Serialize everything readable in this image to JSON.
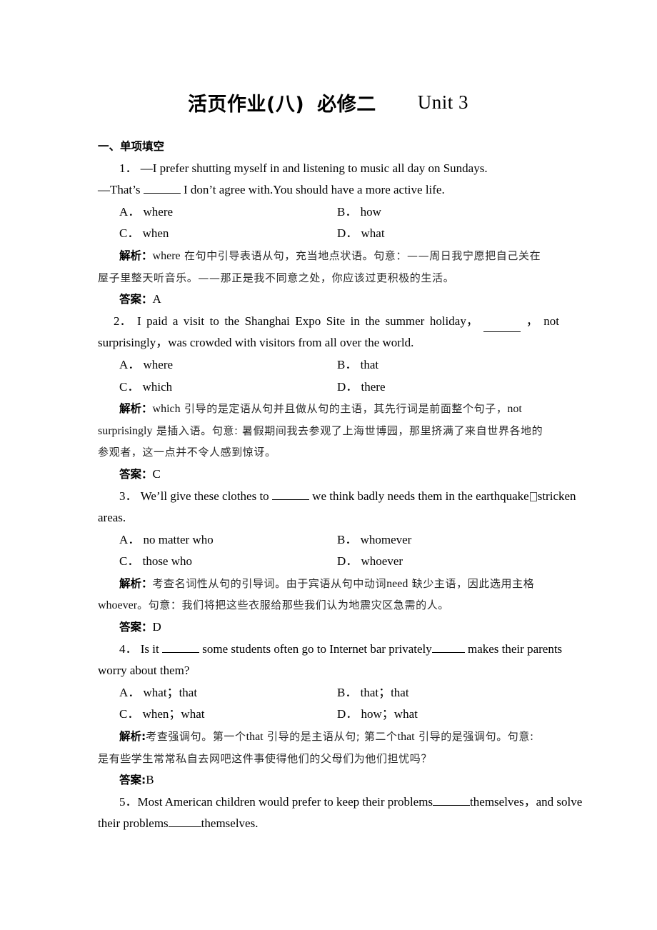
{
  "document": {
    "title_cn": "活页作业(八)",
    "title_cn2": "必修二",
    "title_en": "Unit 3"
  },
  "section": {
    "heading": "一、单项填空"
  },
  "labels": {
    "analysis": "解析",
    "answer": "答案",
    "colon": "："
  },
  "questions": [
    {
      "number": "1．",
      "stem_line1": "—I prefer shutting myself in and listening to music all day on Sundays.",
      "stem_line2_pre": "—That’s",
      "stem_line2_post": "I don’t agree with.You should have a more active life.",
      "options": [
        {
          "key": "A．",
          "text": "where"
        },
        {
          "key": "B．",
          "text": "how"
        },
        {
          "key": "C．",
          "text": "when"
        },
        {
          "key": "D．",
          "text": "what"
        }
      ],
      "analysis_lines": [
        "where 在句中引导表语从句，充当地点状语。句意：——周日我宁愿把自己关在",
        "屋子里整天听音乐。——那正是我不同意之处，你应该过更积极的生活。"
      ],
      "analysis_l1_a": "where",
      "analysis_l1_b": "在句中引导表语从句，充当地点状语。句意：——周日我宁愿把自己关在",
      "analysis_l2": "屋子里整天听音乐。——那正是我不同意之处，你应该过更积极的生活。",
      "answer": "A"
    },
    {
      "number": "2．",
      "stem_l1_words": [
        "I",
        "paid",
        "a",
        "visit",
        "to",
        "the",
        "Shanghai",
        "Expo",
        "Site",
        "in",
        "the",
        "summer",
        "holiday，"
      ],
      "stem_l1_tail": "，  not",
      "stem_line2": "surprisingly，was crowded with visitors from all over the world.",
      "options": [
        {
          "key": "A．",
          "text": "where"
        },
        {
          "key": "B．",
          "text": "that"
        },
        {
          "key": "C．",
          "text": "which"
        },
        {
          "key": "D．",
          "text": "there"
        }
      ],
      "analysis_l1_a": "which",
      "analysis_l1_b": "引导的是定语从句并且做从句的主语，其先行词是前面整个句子，",
      "analysis_l1_c": "not",
      "analysis_l2_a": "surprisingly",
      "analysis_l2_b": "是插入语。句意: 暑假期间我去参观了上海世博园，那里挤满了来自世界各地的",
      "analysis_l3": "参观者，这一点并不令人感到惊讶。",
      "answer": "C"
    },
    {
      "number": "3．",
      "stem_l1_pre": "We’ll give these clothes to",
      "stem_l1_post": "we think badly needs them in the earthquake",
      "stem_l1_post2": "stricken",
      "stem_line2": "areas.",
      "options": [
        {
          "key": "A．",
          "text": "no matter who"
        },
        {
          "key": "B．",
          "text": "whomever"
        },
        {
          "key": "C．",
          "text": "those who"
        },
        {
          "key": "D．",
          "text": "whoever"
        }
      ],
      "analysis_l1_a": "考查名词性从句的引导词。由于宾语从句中动词",
      "analysis_l1_b": "need",
      "analysis_l1_c": "缺少主语，因此选用主格",
      "analysis_l2_a": "whoever",
      "analysis_l2_b": "。句意：我们将把这些衣服给那些我们认为地震灾区急需的人。",
      "answer": "D"
    },
    {
      "number": "4．",
      "stem_l1_pre": "Is it",
      "stem_l1_mid": "some students often go to Internet bar privately",
      "stem_l1_post": "makes their parents",
      "stem_line2": "worry about them?",
      "options": [
        {
          "key": "A．",
          "text": "what；that"
        },
        {
          "key": "B．",
          "text": "that；that"
        },
        {
          "key": "C．",
          "text": "when；what"
        },
        {
          "key": "D．",
          "text": "how；what"
        }
      ],
      "analysis_l1_a": "考查强调句。第一个",
      "analysis_l1_b": "that",
      "analysis_l1_c": "引导的是主语从句; 第二个",
      "analysis_l1_d": "that",
      "analysis_l1_e": "引导的是强调句。句意:",
      "analysis_l2": "是有些学生常常私自去网吧这件事使得他们的父母们为他们担忧吗？",
      "answer": "B"
    },
    {
      "number": "5．",
      "stem_l1_pre": "Most American children would prefer to keep their problems",
      "stem_l1_post": "themselves，and solve",
      "stem_l2_pre": "their problems",
      "stem_l2_post": "themselves."
    }
  ]
}
